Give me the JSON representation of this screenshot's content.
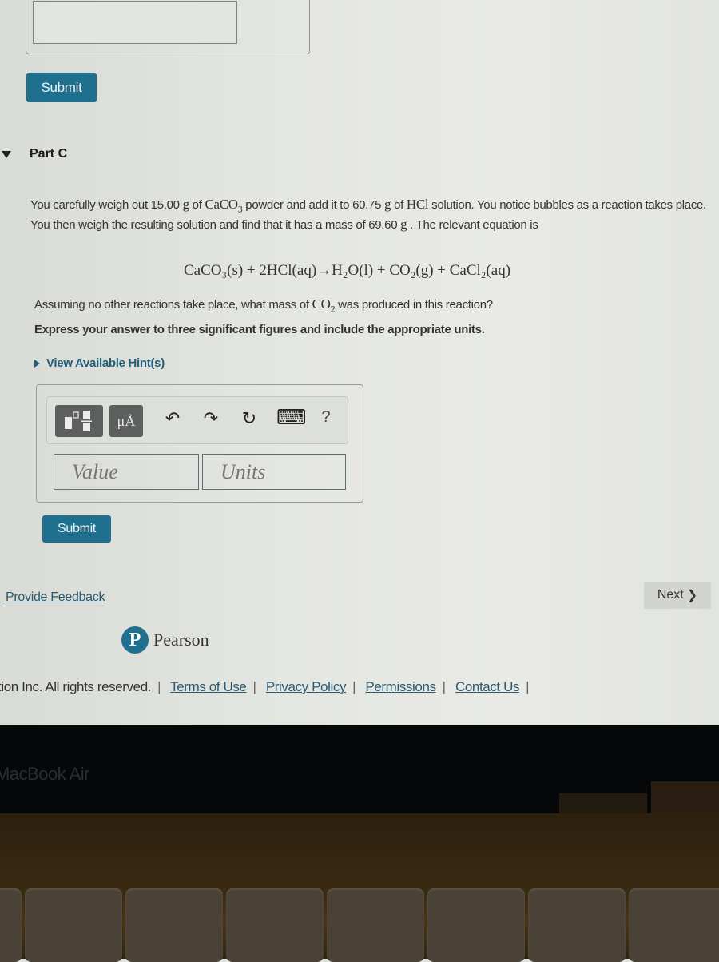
{
  "previous_part": {
    "submit_label": "Submit"
  },
  "part": {
    "title": "Part C",
    "expanded": true
  },
  "question": {
    "text_1": "You carefully weigh out 15.00 ",
    "unit_g": "g",
    "text_2": " of ",
    "caco3": "CaCO",
    "caco3_sub": "3",
    "text_3": " powder and add it to 60.75 ",
    "text_4": " of ",
    "hcl": "HCl",
    "text_5": " solution. You notice bubbles as a reaction takes place. You then weigh the resulting solution and find that it has a mass of 69.60 ",
    "text_6": " . The relevant equation is",
    "equation": "CaCO₃(s) + 2HCl(aq)→H₂O(l) + CO₂(g) + CaCl₂(aq)",
    "ask_1": "Assuming no other reactions take place, what mass of ",
    "ask_co2": "CO",
    "ask_co2_sub": "2",
    "ask_2": " was produced in this reaction?",
    "instruction": "Express your answer to three significant figures and include the appropriate units.",
    "hint_label": "View Available Hint(s)"
  },
  "answer": {
    "toolbar": {
      "templates_icon": "templates-icon",
      "units_label": "μÅ",
      "undo_icon": "↶",
      "redo_icon": "↷",
      "reset_icon": "↻",
      "keyboard_icon": "⌨",
      "help_label": "?"
    },
    "value_placeholder": "Value",
    "units_placeholder": "Units",
    "value": "",
    "units": "",
    "submit_label": "Submit"
  },
  "nav": {
    "feedback_label": "Provide Feedback",
    "next_label": "Next",
    "next_chevron": "❯"
  },
  "footer": {
    "brand": "Pearson",
    "brand_initial": "P",
    "copyright": "tion Inc. All rights reserved.",
    "links": [
      "Terms of Use",
      "Privacy Policy",
      "Permissions",
      "Contact Us"
    ]
  },
  "device": {
    "label": "MacBook Air"
  },
  "colors": {
    "accent": "#1f6f8f",
    "link": "#2a5a70",
    "toolbar_dark": "#5c5f5e"
  }
}
